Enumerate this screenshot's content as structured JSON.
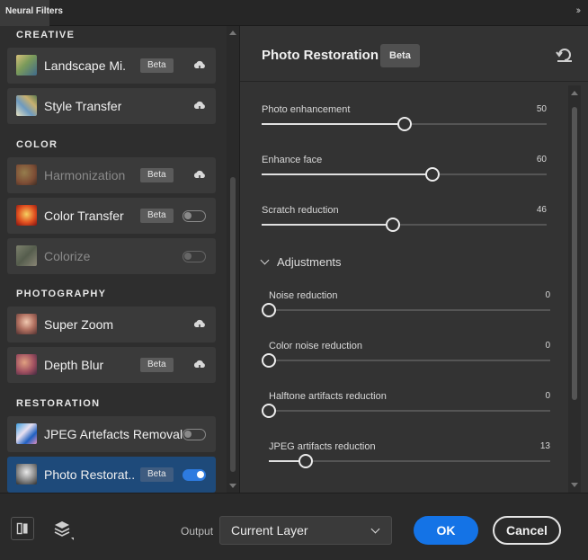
{
  "tab": {
    "title": "Neural Filters",
    "collapse_icon": "double-chevron-right-icon"
  },
  "categories": {
    "creative": "CREATIVE",
    "color": "COLOR",
    "photography": "PHOTOGRAPHY",
    "restoration": "RESTORATION"
  },
  "filters": [
    {
      "label": "Landscape Mi...",
      "badge": "Beta",
      "control": "cloud-download-icon"
    },
    {
      "label": "Style Transfer",
      "badge": "",
      "control": "cloud-download-icon"
    },
    {
      "label": "Harmonization",
      "badge": "Beta",
      "control": "cloud-download-icon"
    },
    {
      "label": "Color Transfer",
      "badge": "Beta",
      "control": "toggle-off"
    },
    {
      "label": "Colorize",
      "badge": "",
      "control": "toggle-off"
    },
    {
      "label": "Super Zoom",
      "badge": "",
      "control": "cloud-download-icon"
    },
    {
      "label": "Depth Blur",
      "badge": "Beta",
      "control": "cloud-download-icon"
    },
    {
      "label": "JPEG Artefacts Removal",
      "badge": "",
      "control": "toggle-off"
    },
    {
      "label": "Photo Restorat...",
      "badge": "Beta",
      "control": "toggle-on"
    }
  ],
  "panel": {
    "title": "Photo Restoration",
    "badge": "Beta",
    "reset_icon": "reset-icon",
    "sliders": [
      {
        "label": "Photo enhancement",
        "value": "50",
        "fraction": 0.5
      },
      {
        "label": "Enhance face",
        "value": "60",
        "fraction": 0.6
      },
      {
        "label": "Scratch reduction",
        "value": "46",
        "fraction": 0.46
      }
    ],
    "adjustments_label": "Adjustments",
    "adjustments": [
      {
        "label": "Noise reduction",
        "value": "0",
        "fraction": 0.0
      },
      {
        "label": "Color noise reduction",
        "value": "0",
        "fraction": 0.0
      },
      {
        "label": "Halftone artifacts reduction",
        "value": "0",
        "fraction": 0.0
      },
      {
        "label": "JPEG artifacts reduction",
        "value": "13",
        "fraction": 0.13
      }
    ]
  },
  "footer": {
    "output_label": "Output",
    "output_value": "Current Layer",
    "ok_label": "OK",
    "cancel_label": "Cancel"
  },
  "colors": {
    "accent": "#1473e6",
    "selected_row": "#1e4a7a",
    "panel_bg": "#333333"
  }
}
